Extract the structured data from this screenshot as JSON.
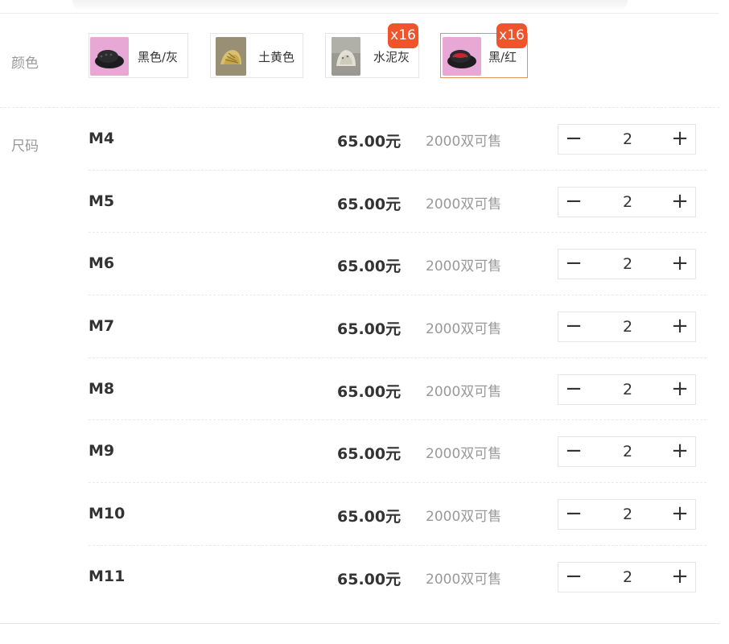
{
  "labels": {
    "color": "颜色",
    "size": "尺码"
  },
  "colors": [
    {
      "name": "黑色/灰",
      "badge": "",
      "selected": false,
      "icon": "black-clog-thumbnail",
      "bg": "#e7a8d6"
    },
    {
      "name": "土黄色",
      "badge": "",
      "selected": false,
      "icon": "khaki-shoe-thumbnail",
      "bg": "#8a8068"
    },
    {
      "name": "水泥灰",
      "badge": "x16",
      "selected": false,
      "icon": "grey-shoe-thumbnail",
      "bg": "#9a9a92"
    },
    {
      "name": "黑/红",
      "badge": "x16",
      "selected": true,
      "icon": "black-red-clog-thumbnail",
      "bg": "#e7a8d6"
    }
  ],
  "sizes": [
    {
      "size": "M4",
      "price": "65.00元",
      "stock": "2000双可售",
      "qty": "2"
    },
    {
      "size": "M5",
      "price": "65.00元",
      "stock": "2000双可售",
      "qty": "2"
    },
    {
      "size": "M6",
      "price": "65.00元",
      "stock": "2000双可售",
      "qty": "2"
    },
    {
      "size": "M7",
      "price": "65.00元",
      "stock": "2000双可售",
      "qty": "2"
    },
    {
      "size": "M8",
      "price": "65.00元",
      "stock": "2000双可售",
      "qty": "2"
    },
    {
      "size": "M9",
      "price": "65.00元",
      "stock": "2000双可售",
      "qty": "2"
    },
    {
      "size": "M10",
      "price": "65.00元",
      "stock": "2000双可售",
      "qty": "2"
    },
    {
      "size": "M11",
      "price": "65.00元",
      "stock": "2000双可售",
      "qty": "2"
    }
  ],
  "stepper": {
    "minus_icon": "minus-icon",
    "plus_icon": "plus-icon"
  },
  "theme": {
    "badge_color": "#f0542b",
    "selected_border": "#e2925e"
  }
}
